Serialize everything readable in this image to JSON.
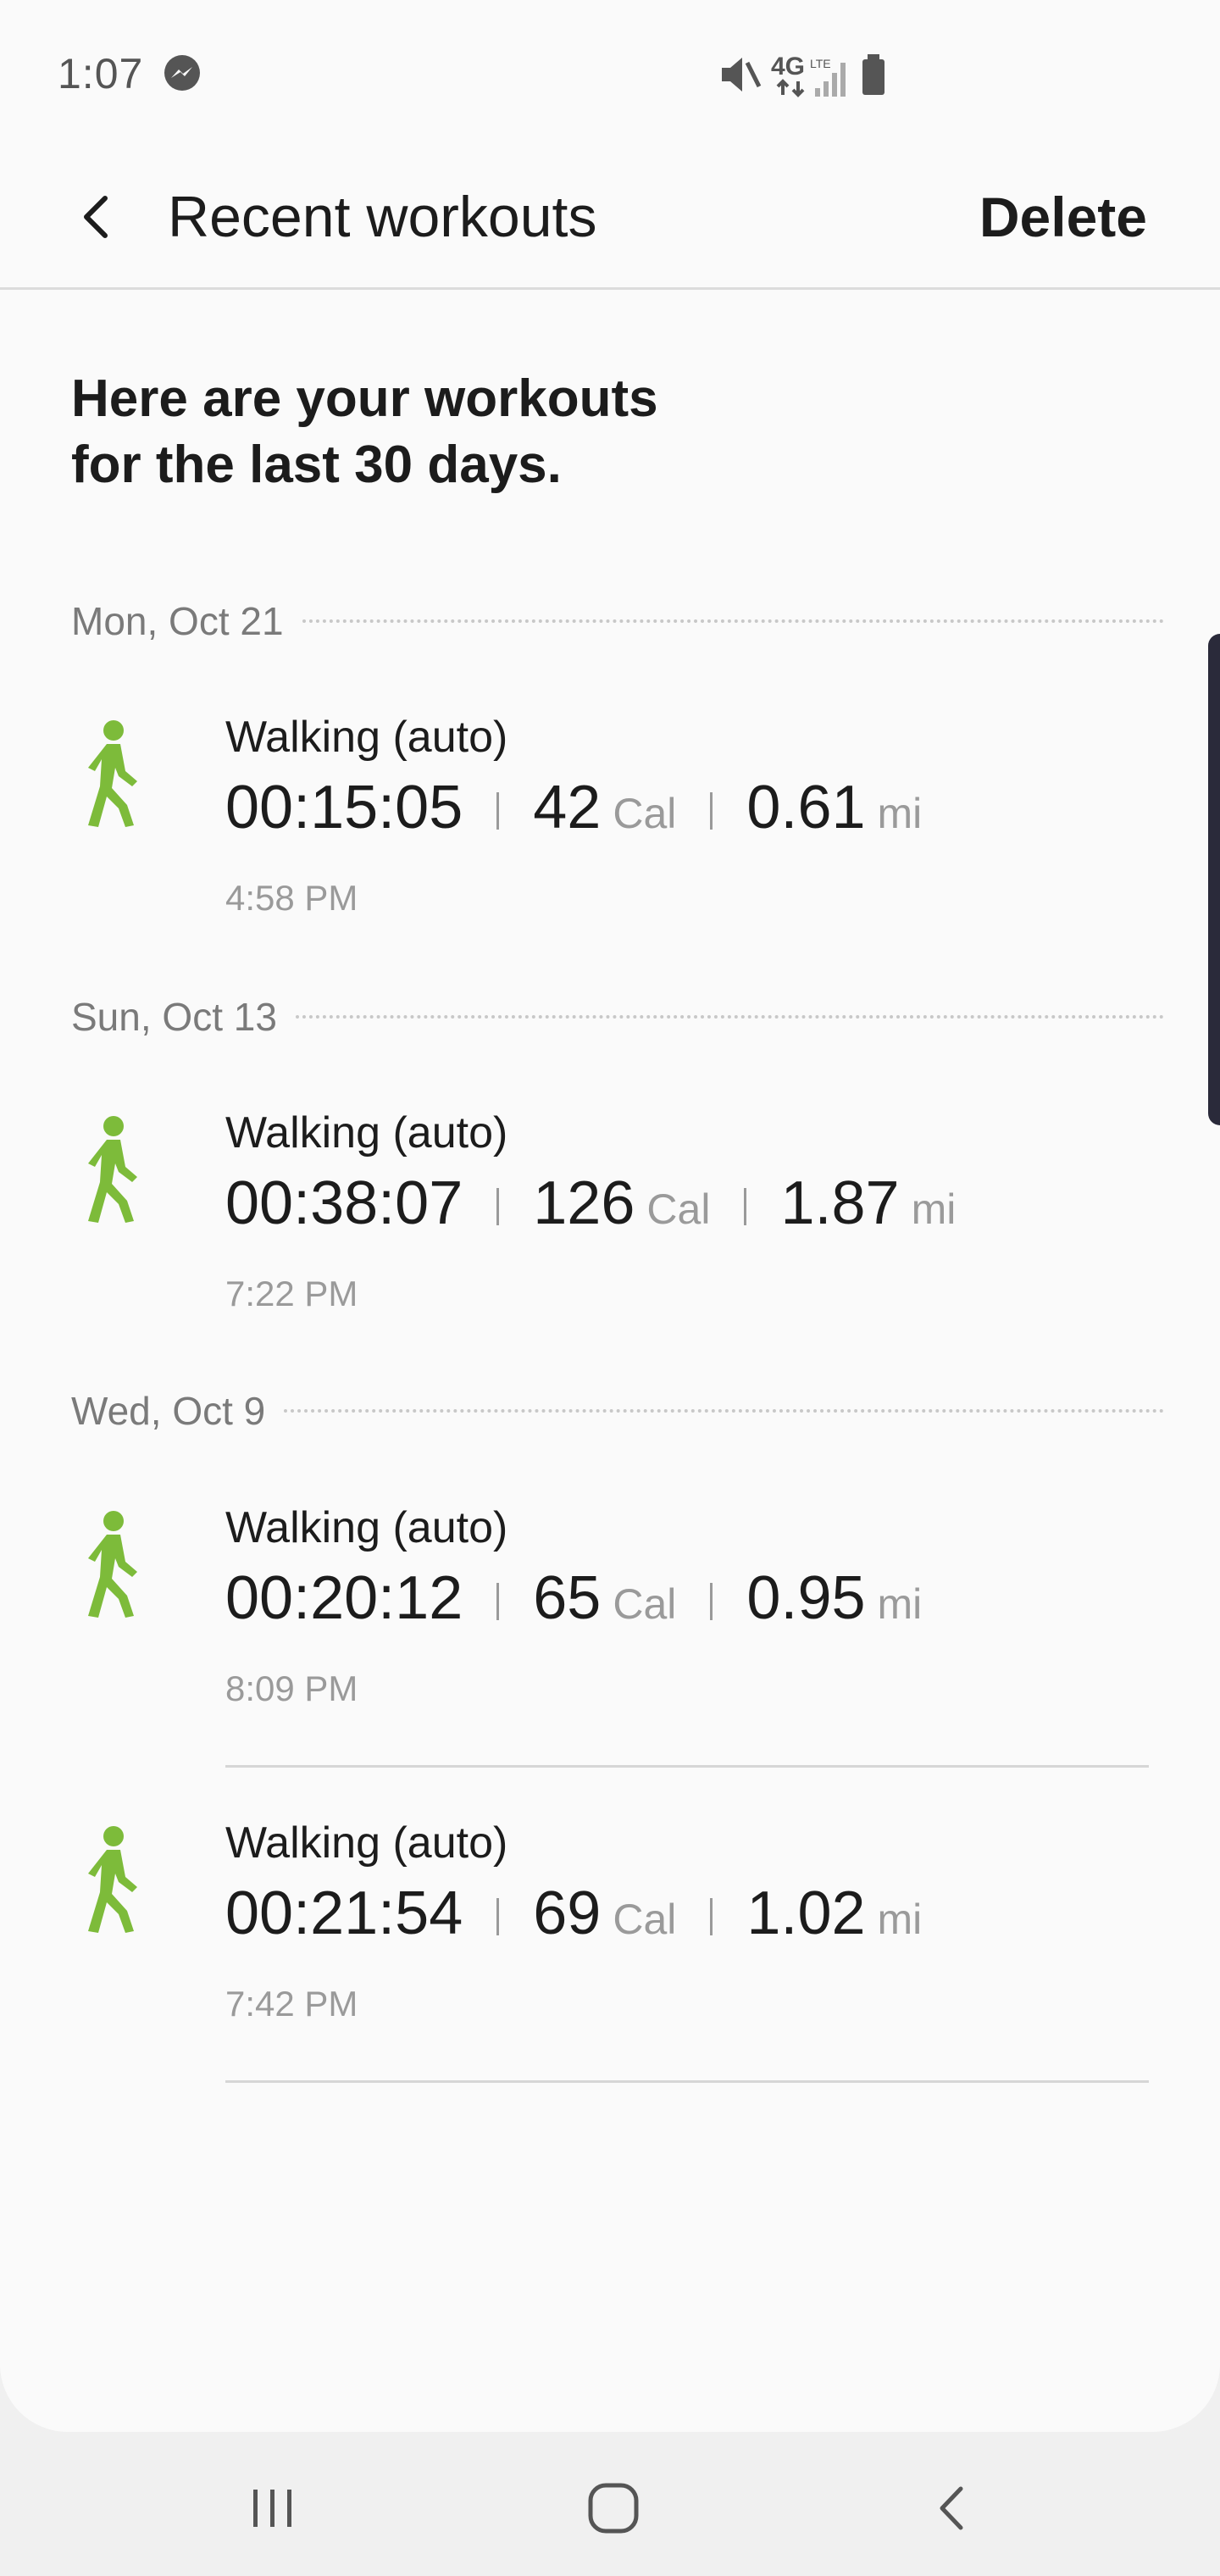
{
  "status_bar": {
    "time": "1:07",
    "icons": [
      "messenger-icon",
      "mute-icon",
      "4g-lte-icon",
      "signal-icon",
      "battery-icon"
    ]
  },
  "app_bar": {
    "title": "Recent workouts",
    "delete_label": "Delete"
  },
  "intro": {
    "line1": "Here are your workouts",
    "line2": "for the last 30 days."
  },
  "groups": [
    {
      "date": "Mon, Oct 21",
      "workouts": [
        {
          "type": "Walking (auto)",
          "duration": "00:15:05",
          "calories": "42",
          "calories_unit": "Cal",
          "distance": "0.61",
          "distance_unit": "mi",
          "time": "4:58 PM"
        }
      ]
    },
    {
      "date": "Sun, Oct 13",
      "workouts": [
        {
          "type": "Walking (auto)",
          "duration": "00:38:07",
          "calories": "126",
          "calories_unit": "Cal",
          "distance": "1.87",
          "distance_unit": "mi",
          "time": "7:22 PM"
        }
      ]
    },
    {
      "date": "Wed, Oct 9",
      "workouts": [
        {
          "type": "Walking (auto)",
          "duration": "00:20:12",
          "calories": "65",
          "calories_unit": "Cal",
          "distance": "0.95",
          "distance_unit": "mi",
          "time": "8:09 PM"
        },
        {
          "type": "Walking (auto)",
          "duration": "00:21:54",
          "calories": "69",
          "calories_unit": "Cal",
          "distance": "1.02",
          "distance_unit": "mi",
          "time": "7:42 PM"
        }
      ]
    }
  ],
  "colors": {
    "accent_green": "#7dbb3a",
    "text_primary": "#1c1c1c",
    "text_secondary": "#9a9a9a"
  },
  "nav_bar": {
    "icons": [
      "recents-icon",
      "home-icon",
      "back-icon"
    ]
  }
}
